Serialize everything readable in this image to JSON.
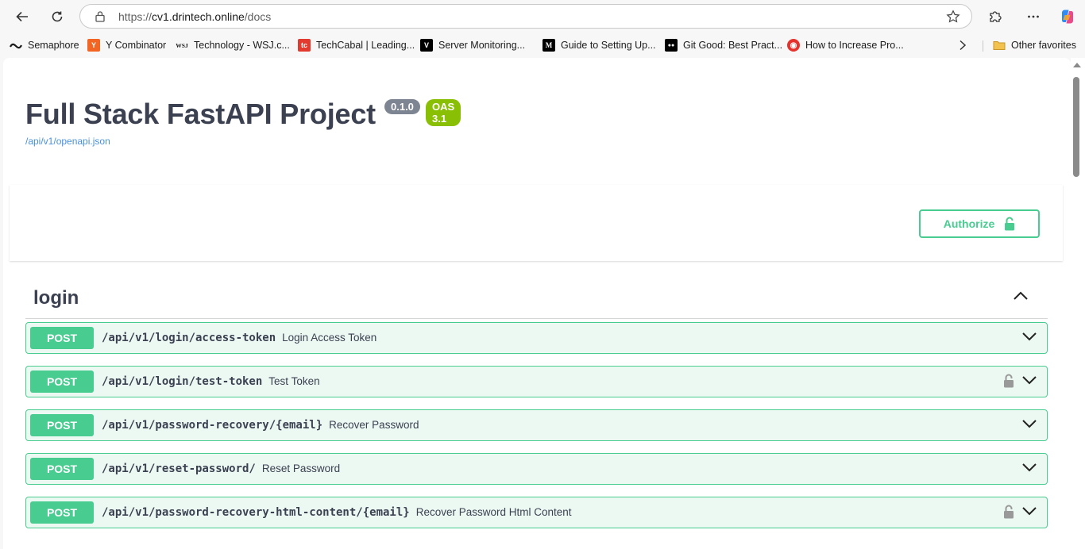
{
  "browser": {
    "url_scheme": "https://",
    "url_host": "cv1.drintech.online",
    "url_path": "/docs"
  },
  "bookmarks": [
    {
      "label": "Semaphore",
      "icon": "semaphore-icon",
      "color": "#1b1b1b",
      "glyph": ""
    },
    {
      "label": "Y Combinator",
      "icon": "ycombinator-icon",
      "color": "#f26522",
      "glyph": "Y"
    },
    {
      "label": "Technology - WSJ.c...",
      "icon": "wsj-icon",
      "color": "#ffffff",
      "glyph": "WSJ"
    },
    {
      "label": "TechCabal | Leading...",
      "icon": "techcabal-icon",
      "color": "#e23a2e",
      "glyph": "tc"
    },
    {
      "label": "Server Monitoring...",
      "icon": "server-monitoring-icon",
      "color": "#000000",
      "glyph": "V"
    },
    {
      "label": "Guide to Setting Up...",
      "icon": "medium-icon",
      "color": "#000000",
      "glyph": "M"
    },
    {
      "label": "Git Good: Best Pract...",
      "icon": "medium-icon",
      "color": "#000000",
      "glyph": "●●"
    },
    {
      "label": "How to Increase Pro...",
      "icon": "eye-icon",
      "color": "#e5322d",
      "glyph": "◉"
    },
    {
      "label": "Other favorites",
      "icon": "folder-icon",
      "color": "#f2c14e",
      "glyph": ""
    }
  ],
  "api": {
    "title": "Full Stack FastAPI Project",
    "version": "0.1.0",
    "oas": "OAS 3.1",
    "spec_url": "/api/v1/openapi.json",
    "authorize_label": "Authorize"
  },
  "tag": {
    "name": "login",
    "expanded": true
  },
  "operations": [
    {
      "method": "POST",
      "path": "/api/v1/login/access-token",
      "summary": "Login Access Token",
      "locked": false
    },
    {
      "method": "POST",
      "path": "/api/v1/login/test-token",
      "summary": "Test Token",
      "locked": true
    },
    {
      "method": "POST",
      "path": "/api/v1/password-recovery/{email}",
      "summary": "Recover Password",
      "locked": false
    },
    {
      "method": "POST",
      "path": "/api/v1/reset-password/",
      "summary": "Reset Password",
      "locked": false
    },
    {
      "method": "POST",
      "path": "/api/v1/password-recovery-html-content/{email}",
      "summary": "Recover Password Html Content",
      "locked": true
    }
  ],
  "colors": {
    "post": "#49cc90",
    "post_bg": "#ecf8f2",
    "version_badge": "#7d8492",
    "oas_badge": "#89bf04",
    "link": "#4990e2"
  }
}
